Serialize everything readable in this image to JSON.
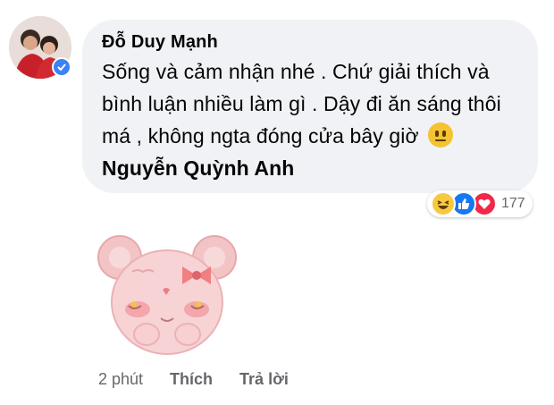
{
  "comment": {
    "author": "Đỗ Duy Mạnh",
    "text": "Sống và cảm nhận nhé . Chứ giải thích và bình luận nhiều làm gì . Dậy đi ăn sáng thôi má , không ngta đóng cửa bây giờ",
    "emoji": "neutral-face-icon",
    "mention": "Nguyễn Quỳnh Anh",
    "reaction_count": "177",
    "reactions": [
      "haha-icon",
      "like-icon",
      "love-icon"
    ]
  },
  "actions": {
    "time": "2 phút",
    "like_label": "Thích",
    "reply_label": "Trả lời"
  },
  "colors": {
    "bubble": "#f0f2f5",
    "verified": "#3b82f6",
    "like": "#1877f2",
    "love": "#f02849",
    "muted": "#65676b"
  }
}
